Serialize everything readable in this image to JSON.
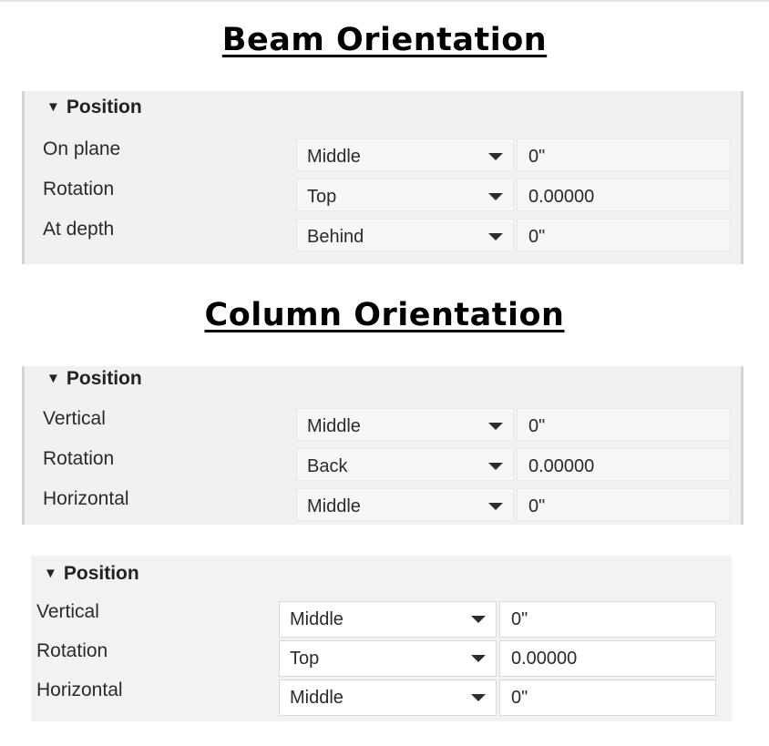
{
  "beam": {
    "heading": "Beam Orientation",
    "panel_title": "Position",
    "rows": [
      {
        "label": "On plane",
        "option": "Middle",
        "value": "0\""
      },
      {
        "label": "Rotation",
        "option": "Top",
        "value": "0.00000"
      },
      {
        "label": "At depth",
        "option": "Behind",
        "value": "0\""
      }
    ]
  },
  "column": {
    "heading": "Column Orientation",
    "panel_title": "Position",
    "rows": [
      {
        "label": "Vertical",
        "option": "Middle",
        "value": "0\""
      },
      {
        "label": "Rotation",
        "option": "Back",
        "value": "0.00000"
      },
      {
        "label": "Horizontal",
        "option": "Middle",
        "value": "0\""
      }
    ]
  },
  "column_alt": {
    "panel_title": "Position",
    "rows": [
      {
        "label": "Vertical",
        "option": "Middle",
        "value": "0\""
      },
      {
        "label": "Rotation",
        "option": "Top",
        "value": "0.00000"
      },
      {
        "label": "Horizontal",
        "option": "Middle",
        "value": "0\""
      }
    ]
  },
  "icons": {
    "collapse": "triangle-down-icon",
    "dropdown": "chevron-down-icon"
  }
}
